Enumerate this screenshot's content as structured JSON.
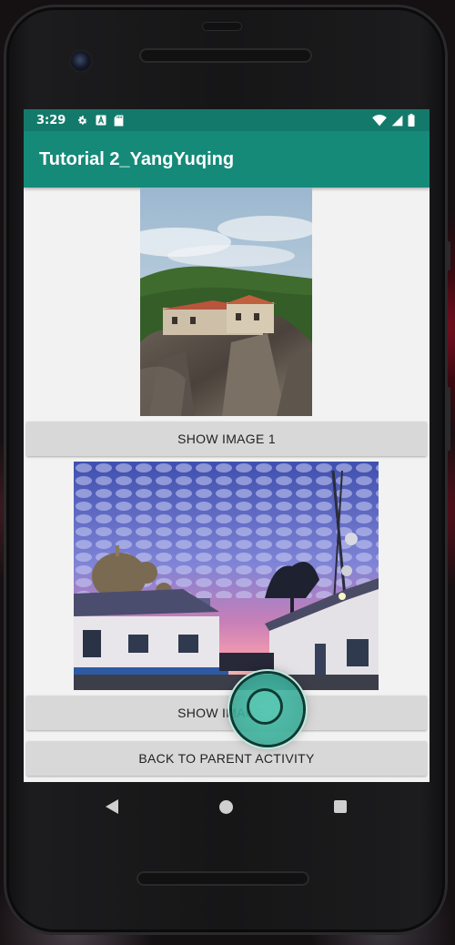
{
  "status_bar": {
    "time": "3:29",
    "icons_left": [
      "gear-icon",
      "a-icon",
      "sd-card-icon"
    ],
    "icons_right": [
      "wifi-icon",
      "signal-icon",
      "battery-icon"
    ]
  },
  "app_bar": {
    "title": "Tutorial 2_YangYuqing"
  },
  "content": {
    "image1": "cliff-monastery-image",
    "button1": "SHOW IMAGE 1",
    "image2": "mosque-sunset-image",
    "button2": "SHOW IMAGE 2",
    "button3": "BACK TO PARENT ACTIVITY"
  },
  "navigation": {
    "items": [
      "back-icon",
      "home-icon",
      "recents-icon"
    ]
  },
  "colors": {
    "status_bar": "#137a6b",
    "app_bar": "#158a79",
    "button": "#d8d8d8",
    "background": "#f2f2f2"
  }
}
